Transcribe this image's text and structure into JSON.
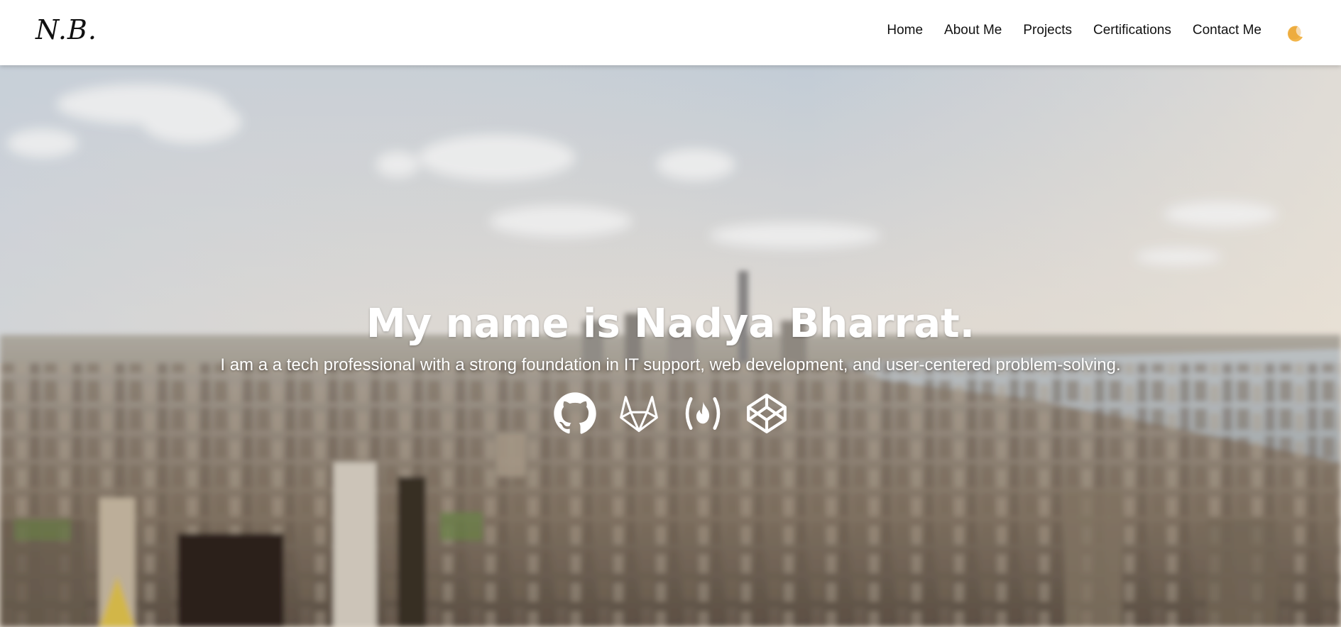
{
  "navbar": {
    "logo": "N.B.",
    "links": [
      {
        "label": "Home"
      },
      {
        "label": "About Me"
      },
      {
        "label": "Projects"
      },
      {
        "label": "Certifications"
      },
      {
        "label": "Contact Me"
      }
    ],
    "theme_toggle_icon": "moon-icon"
  },
  "hero": {
    "title": "My name is Nadya Bharrat.",
    "subtitle": "I am a a tech professional with a strong foundation in IT support, web development, and user-centered problem-solving.",
    "social_icons": [
      "github-icon",
      "gitlab-icon",
      "freecodecamp-icon",
      "codepen-icon"
    ]
  },
  "colors": {
    "text_dark": "#111111",
    "hero_text": "#ffffff",
    "moon": "#f2b54a"
  }
}
